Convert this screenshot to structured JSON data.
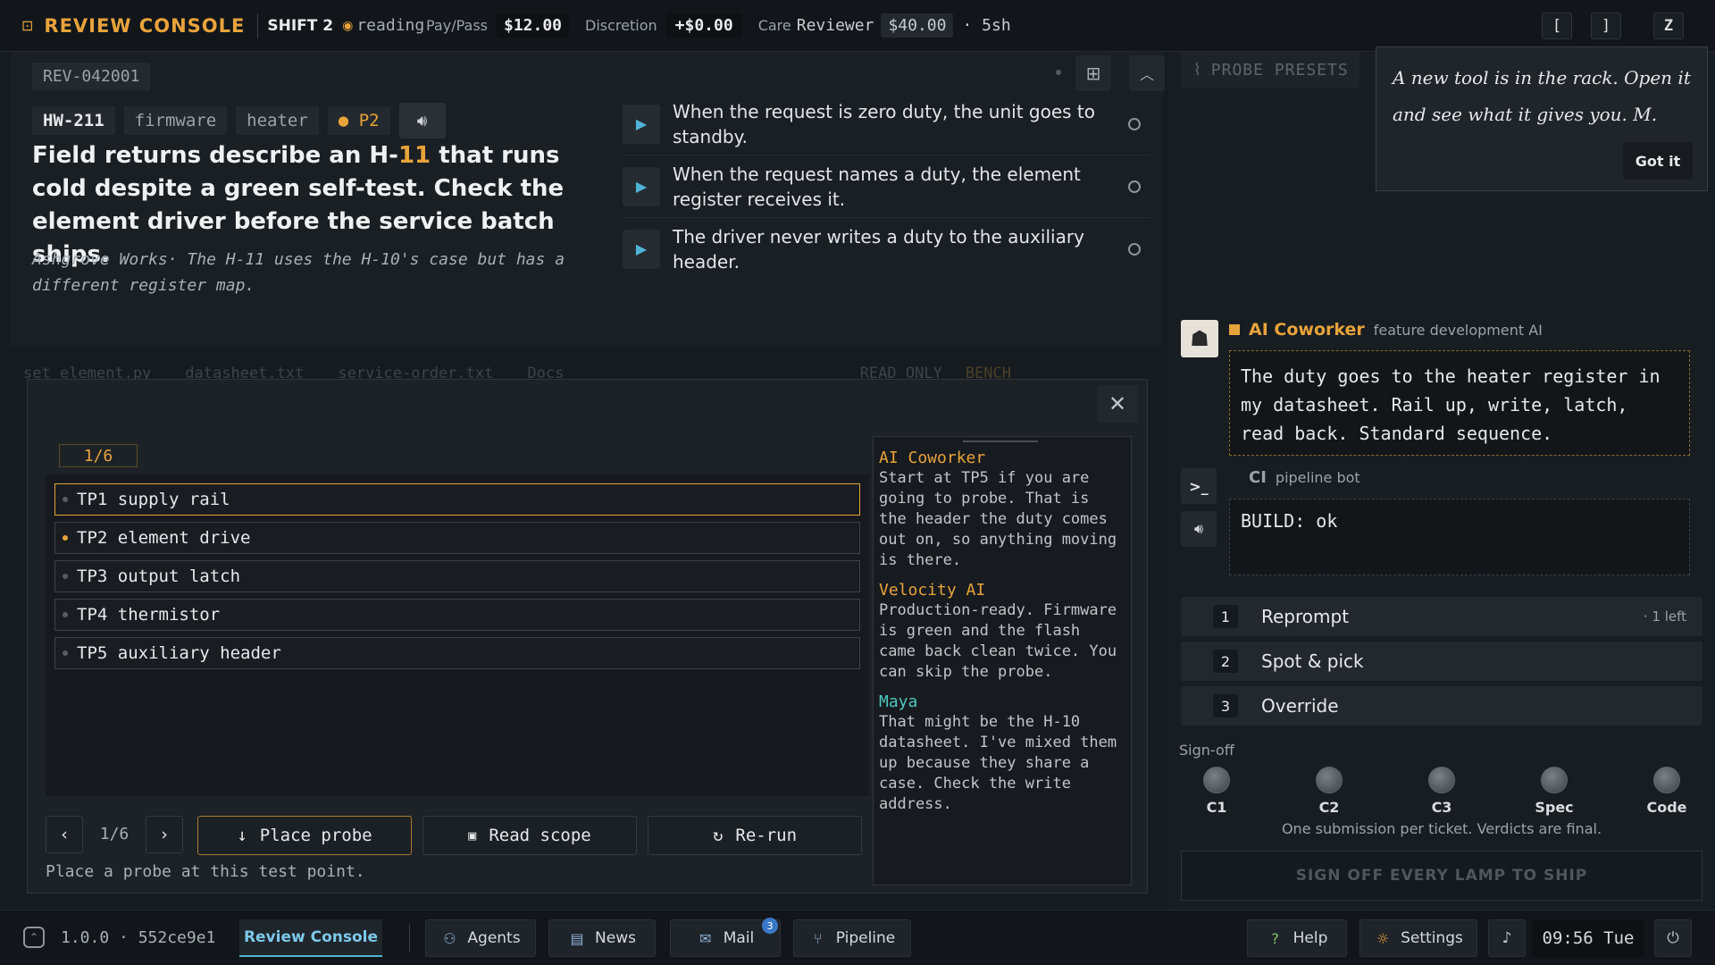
{
  "topbar": {
    "app_title": "REVIEW CONSOLE",
    "shift": "SHIFT 2",
    "status": "reading",
    "paypass_label": "Pay/Pass",
    "paypass_value": "$12.00",
    "discretion_label": "Discretion",
    "discretion_value": "+$0.00",
    "care_label": "Care",
    "care_role": "Reviewer",
    "care_value": "$40.00",
    "care_time": "· 5sh",
    "keys": [
      "[",
      "]",
      "Z"
    ]
  },
  "ticket": {
    "id": "REV-042001",
    "tags": [
      "HW-211",
      "firmware",
      "heater"
    ],
    "priority": "P2",
    "headline_pre": "Field returns describe an H-",
    "headline_hl": "11",
    "headline_post": " that runs cold despite a green self-test. Check the element driver before the service batch ships.",
    "subtitle": "Ashgrove Works· The H-11 uses the H-10's case but has a different register map.",
    "criteria": [
      "When the request is zero duty, the unit goes to standby.",
      "When the request names a duty, the element register receives it.",
      "The driver never writes a duty to the auxiliary header."
    ]
  },
  "file_tabs": [
    "set_element.py",
    "datasheet.txt",
    "service-order.txt",
    "Docs"
  ],
  "file_status": [
    "READ ONLY",
    "BENCH"
  ],
  "modal": {
    "counter": "1/6",
    "test_points": [
      "TP1 supply rail",
      "TP2 element drive",
      "TP3 output latch",
      "TP4 thermistor",
      "TP5 auxiliary header"
    ],
    "pager": "1/6",
    "buttons": {
      "place": "Place probe",
      "read": "Read scope",
      "rerun": "Re-run"
    },
    "hint": "Place a probe at this test point.",
    "notes": [
      {
        "author": "AI Coworker",
        "text": "Start at TP5 if you are going to probe. That is the header the duty comes out on, so anything moving is there.",
        "color": "#e8a33b"
      },
      {
        "author": "Velocity AI",
        "text": "Production-ready. Firmware is green and the flash came back clean twice. You can skip the probe.",
        "color": "#e8a33b"
      },
      {
        "author": "Maya",
        "text": "That might be the H-10 datasheet. I've mixed them up because they share a case. Check the write address.",
        "color": "#4fc6c0"
      }
    ]
  },
  "right": {
    "probe_presets": "PROBE PRESETS",
    "toast": {
      "text": "A new tool is in the rack. Open it and see what it gives you. M.",
      "button": "Got it"
    },
    "coworker": {
      "name": "AI Coworker",
      "role": "feature development AI",
      "message": "The duty goes to the heater register in my datasheet. Rail up, write, latch, read back. Standard sequence."
    },
    "ci": {
      "name": "CI",
      "role": "pipeline bot",
      "message": "BUILD: ok"
    },
    "options": [
      {
        "num": "1",
        "label": "Reprompt",
        "meta": "· 1 left"
      },
      {
        "num": "2",
        "label": "Spot & pick",
        "meta": ""
      },
      {
        "num": "3",
        "label": "Override",
        "meta": ""
      }
    ],
    "signoff_label": "Sign-off",
    "lamps": [
      "C1",
      "C2",
      "C3",
      "Spec",
      "Code"
    ],
    "note": "One submission per ticket. Verdicts are final.",
    "ship_button": "SIGN OFF EVERY LAMP TO SHIP"
  },
  "bottombar": {
    "version": "1.0.0 · 552ce9e1",
    "tabs": [
      "Review Console",
      "Agents",
      "News",
      "Mail",
      "Pipeline"
    ],
    "mail_badge": "3",
    "help": "Help",
    "settings": "Settings",
    "clock": "09:56 Tue"
  },
  "colors": {
    "accent": "#e8a33b",
    "cyan": "#4fb3d6",
    "teal": "#4fc6c0"
  }
}
